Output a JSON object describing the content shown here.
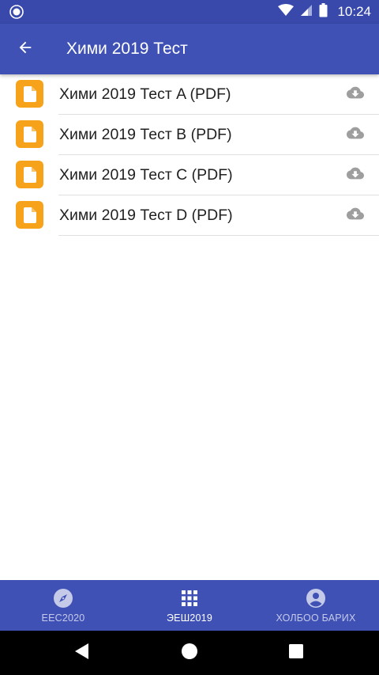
{
  "status_bar": {
    "time": "10:24",
    "icons": [
      "circle-status-icon",
      "wifi-icon",
      "signal-icon",
      "battery-icon"
    ]
  },
  "app_bar": {
    "title": "Хими 2019 Тест",
    "back_icon": "arrow-back-icon"
  },
  "files": [
    {
      "label": "Хими 2019 Тест A (PDF)",
      "icon": "document-icon",
      "action_icon": "cloud-download-icon"
    },
    {
      "label": "Хими 2019 Тест B (PDF)",
      "icon": "document-icon",
      "action_icon": "cloud-download-icon"
    },
    {
      "label": "Хими 2019 Тест C (PDF)",
      "icon": "document-icon",
      "action_icon": "cloud-download-icon"
    },
    {
      "label": "Хими 2019 Тест D (PDF)",
      "icon": "document-icon",
      "action_icon": "cloud-download-icon"
    }
  ],
  "bottom_nav": {
    "items": [
      {
        "label": "ЕЕС2020",
        "icon": "compass-icon",
        "active": false
      },
      {
        "label": "ЭЕШ2019",
        "icon": "grid-icon",
        "active": true
      },
      {
        "label": "ХОЛБОО БАРИХ",
        "icon": "account-circle-icon",
        "active": false
      }
    ]
  },
  "system_nav": {
    "icons": [
      "back-triangle-icon",
      "home-circle-icon",
      "recents-square-icon"
    ]
  },
  "colors": {
    "primary": "#3f51b5",
    "primary_dark": "#3949ab",
    "file_icon": "#f7a21b",
    "download_icon": "#9e9e9e",
    "text": "#212121",
    "divider": "#e0e0e0"
  }
}
